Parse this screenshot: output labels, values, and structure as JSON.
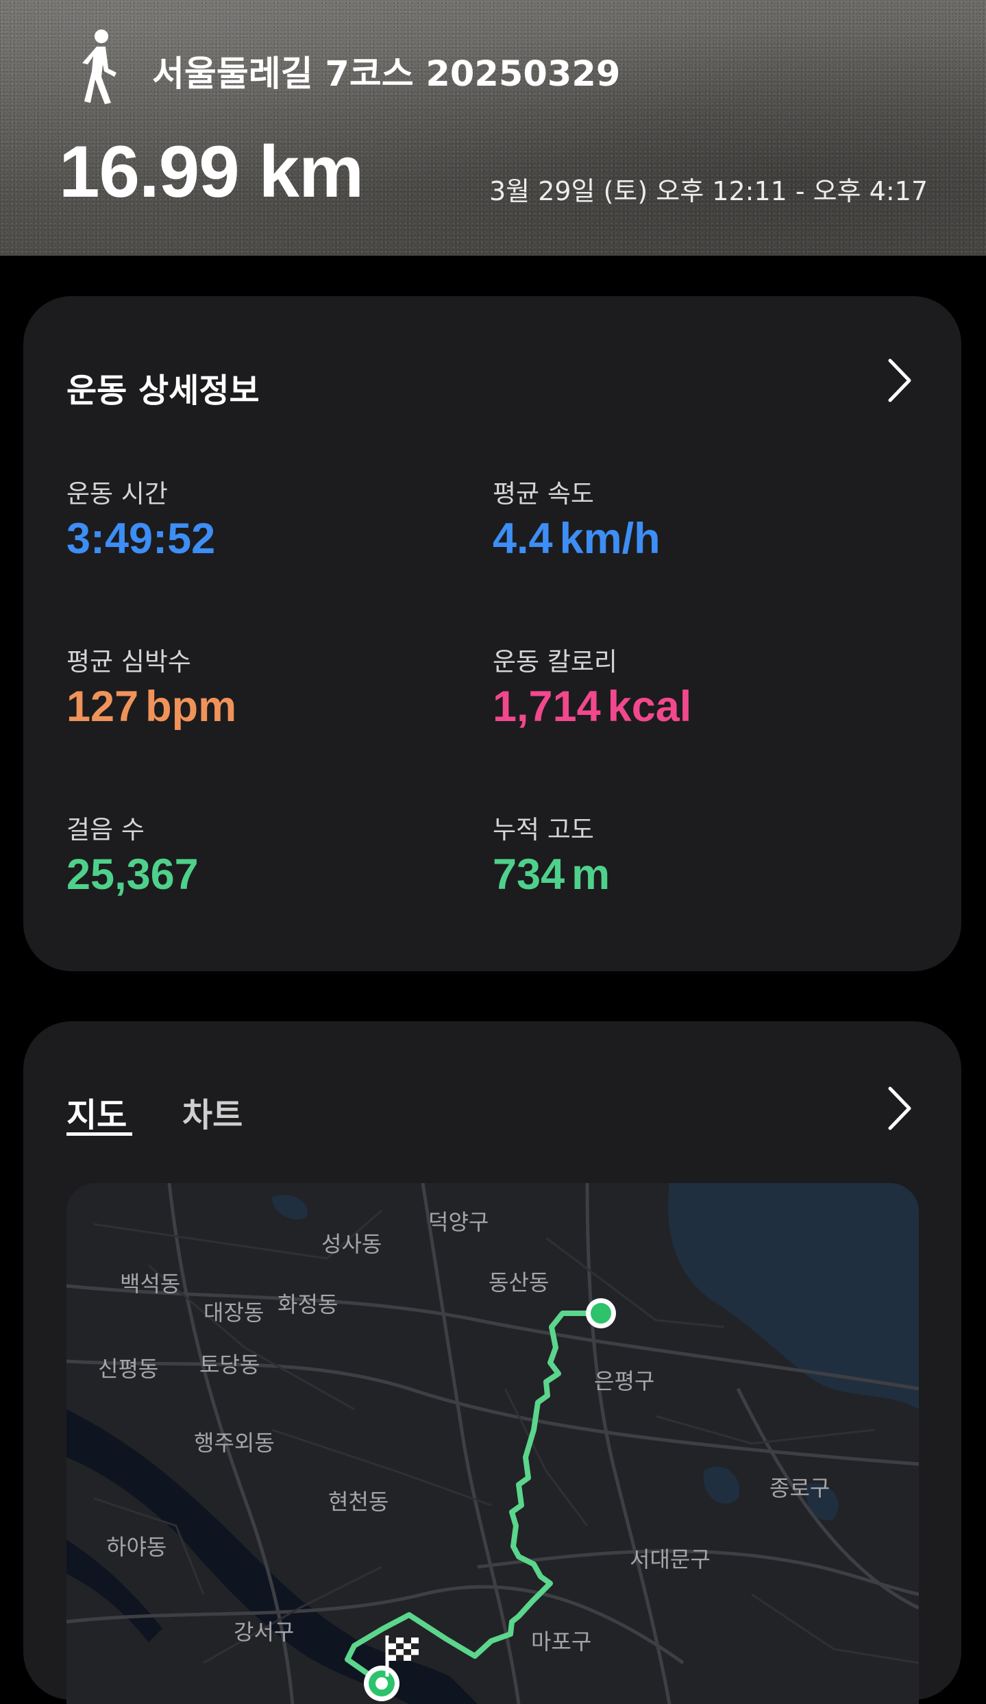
{
  "header": {
    "activity_icon": "walking-person-icon",
    "title": "서울둘레길 7코스 20250329",
    "distance": "16.99 km",
    "time_range": "3월 29일 (토) 오후 12:11 - 오후 4:17"
  },
  "details": {
    "title": "운동 상세정보",
    "stats": [
      {
        "label": "운동 시간",
        "value": "3:49:52",
        "unit": "",
        "color": "#3d8ef5"
      },
      {
        "label": "평균 속도",
        "value": "4.4",
        "unit": "km/h",
        "color": "#3d8ef5"
      },
      {
        "label": "평균 심박수",
        "value": "127",
        "unit": "bpm",
        "color": "#f0935a"
      },
      {
        "label": "운동 칼로리",
        "value": "1,714",
        "unit": "kcal",
        "color": "#f2488d"
      },
      {
        "label": "걸음 수",
        "value": "25,367",
        "unit": "",
        "color": "#4fd18b"
      },
      {
        "label": "누적 고도",
        "value": "734",
        "unit": "m",
        "color": "#4fd18b"
      }
    ]
  },
  "map_card": {
    "tabs": [
      "지도",
      "차트"
    ],
    "active_tab": "지도",
    "route_color": "#5bd68c",
    "map_labels": {
      "deogyang": "덕양구",
      "seongsa": "성사동",
      "baekseok": "백석동",
      "daejang": "대장동",
      "hwajeong": "화정동",
      "dongsan": "동산동",
      "sinpyeong": "신평동",
      "todang": "토당동",
      "eunpyeong": "은평구",
      "haengju": "행주외동",
      "hyeoncheon": "현천동",
      "jongno": "종로구",
      "haya": "하야동",
      "seodaemun": "서대문구",
      "gangseo": "강서구",
      "mapo": "마포구"
    }
  }
}
